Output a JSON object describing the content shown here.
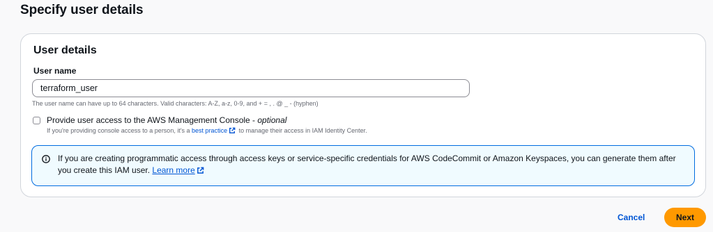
{
  "page": {
    "title": "Specify user details"
  },
  "card": {
    "title": "User details",
    "user_name": {
      "label": "User name",
      "value": "terraform_user",
      "constraint": "The user name can have up to 64 characters. Valid characters: A-Z, a-z, 0-9, and + = , . @ _ - (hyphen)"
    },
    "console_access": {
      "checked": false,
      "label": "Provide user access to the AWS Management Console - ",
      "optional": "optional",
      "desc_before": "If you're providing console access to a person, it's a ",
      "desc_link": "best practice",
      "desc_after": " to manage their access in IAM Identity Center."
    },
    "info": {
      "icon": "info-icon",
      "text": "If you are creating programmatic access through access keys or service-specific credentials for AWS CodeCommit or Amazon Keyspaces, you can generate them after you create this IAM user. ",
      "link": "Learn more"
    }
  },
  "footer": {
    "cancel_label": "Cancel",
    "next_label": "Next"
  },
  "colors": {
    "link": "#0055d4",
    "primary_button": "#ff9900",
    "info_border": "#006ce0",
    "info_background": "#f0fbff"
  }
}
